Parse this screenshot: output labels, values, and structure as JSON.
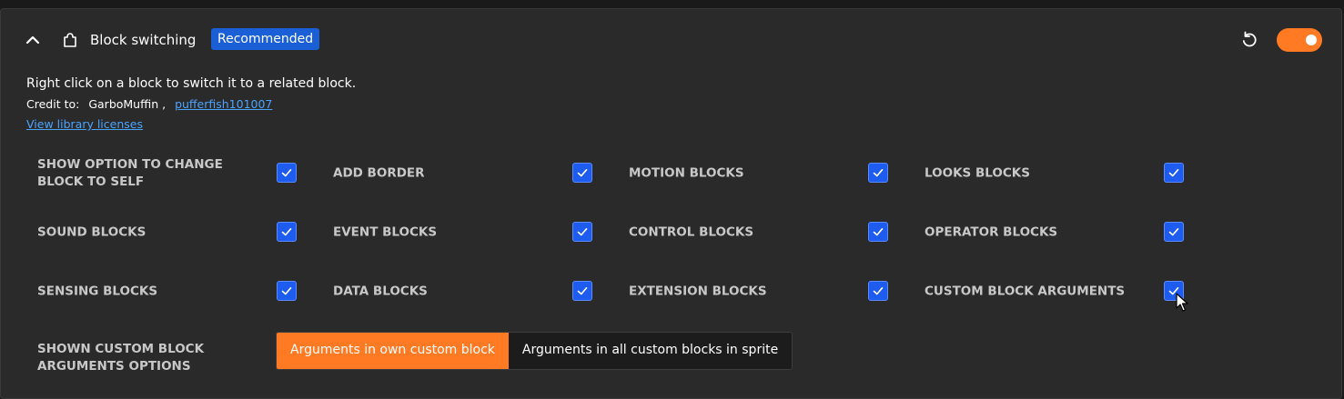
{
  "addon": {
    "title": "Block switching",
    "badge": "Recommended",
    "enabled": true,
    "description": "Right click on a block to switch it to a related block.",
    "credit_label": "Credit to:",
    "credits": [
      "GarboMuffin ,",
      "pufferfish101007"
    ],
    "licenses_link": "View library licenses"
  },
  "settings": [
    {
      "label": "SHOW OPTION TO CHANGE BLOCK TO SELF",
      "checked": true
    },
    {
      "label": "ADD BORDER",
      "checked": true
    },
    {
      "label": "MOTION BLOCKS",
      "checked": true
    },
    {
      "label": "LOOKS BLOCKS",
      "checked": true
    },
    {
      "label": "SOUND BLOCKS",
      "checked": true
    },
    {
      "label": "EVENT BLOCKS",
      "checked": true
    },
    {
      "label": "CONTROL BLOCKS",
      "checked": true
    },
    {
      "label": "OPERATOR BLOCKS",
      "checked": true
    },
    {
      "label": "SENSING BLOCKS",
      "checked": true
    },
    {
      "label": "DATA BLOCKS",
      "checked": true
    },
    {
      "label": "EXTENSION BLOCKS",
      "checked": true
    },
    {
      "label": "CUSTOM BLOCK ARGUMENTS",
      "checked": true
    }
  ],
  "arguments_option": {
    "label": "SHOWN CUSTOM BLOCK ARGUMENTS OPTIONS",
    "options": [
      "Arguments in own custom block",
      "Arguments in all custom blocks in sprite"
    ],
    "selected": "Arguments in own custom block"
  },
  "colors": {
    "accent": "#ff7a22",
    "checkbox": "#1e5cf0",
    "badge": "#1a5fd6",
    "link": "#4ba3ff"
  },
  "icons": [
    "chevron-up-icon",
    "puzzle-icon",
    "reset-icon",
    "check-icon",
    "mouse-cursor-icon"
  ]
}
